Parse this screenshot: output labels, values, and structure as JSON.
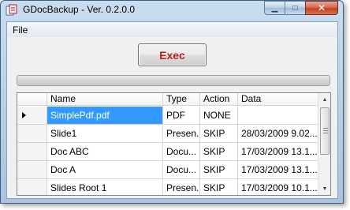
{
  "window": {
    "title": "GDocBackup - Ver. 0.2.0.0",
    "controls": {
      "minimize": "▁",
      "maximize": "□",
      "close": "✕"
    }
  },
  "menu": {
    "file": "File"
  },
  "exec_button": {
    "label": "Exec",
    "color": "#c0201c"
  },
  "progress": {
    "value": 0
  },
  "grid": {
    "columns": [
      "Name",
      "Type",
      "Action",
      "Data"
    ],
    "rows": [
      {
        "name": "SimplePdf.pdf",
        "type": "PDF",
        "action": "NONE",
        "data": "",
        "selected": true
      },
      {
        "name": "Slide1",
        "type": "Presen...",
        "action": "SKIP",
        "data": "28/03/2009 9.02..."
      },
      {
        "name": "Doc ABC",
        "type": "Docu...",
        "action": "SKIP",
        "data": "17/03/2009 13.1..."
      },
      {
        "name": "Doc A",
        "type": "Docu...",
        "action": "SKIP",
        "data": "17/03/2009 13.1..."
      },
      {
        "name": "Slides Root 1",
        "type": "Presen...",
        "action": "SKIP",
        "data": "17/03/2009 10.1..."
      }
    ]
  },
  "colors": {
    "selection": "#3399ff",
    "title_bar": "#a9c4de"
  }
}
